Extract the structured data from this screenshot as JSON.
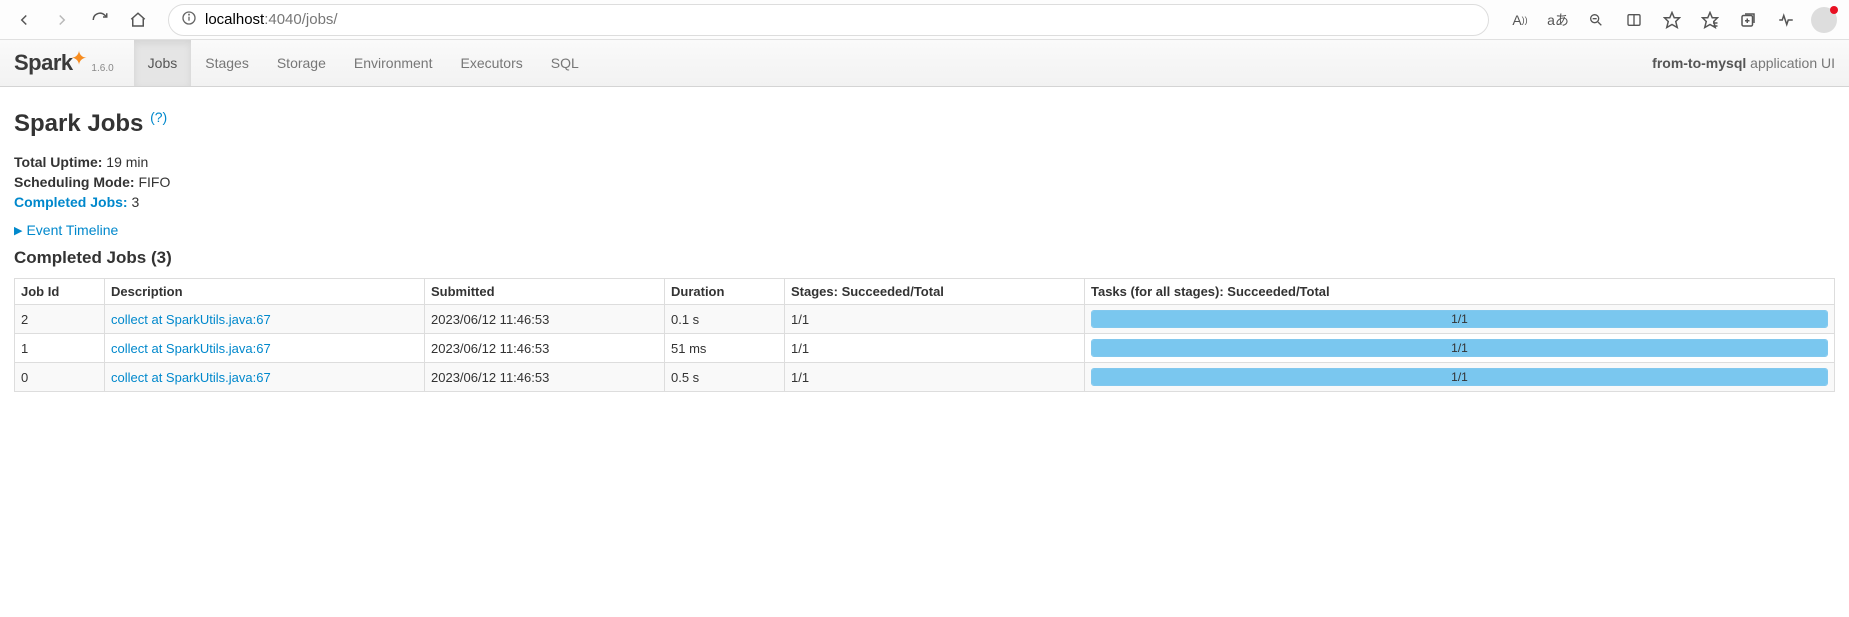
{
  "browser": {
    "url_host": "localhost",
    "url_port": ":4040",
    "url_path": "/jobs/"
  },
  "nav": {
    "version": "1.6.0",
    "tabs": [
      "Jobs",
      "Stages",
      "Storage",
      "Environment",
      "Executors",
      "SQL"
    ],
    "active_tab": "Jobs",
    "app_name": "from-to-mysql",
    "app_suffix": "application UI"
  },
  "page": {
    "title": "Spark Jobs",
    "help": "(?)",
    "summary": {
      "uptime_label": "Total Uptime:",
      "uptime_value": "19 min",
      "sched_label": "Scheduling Mode:",
      "sched_value": "FIFO",
      "completed_label": "Completed Jobs:",
      "completed_value": "3"
    },
    "timeline_label": "Event Timeline",
    "section_title": "Completed Jobs (3)",
    "table": {
      "headers": {
        "jobid": "Job Id",
        "desc": "Description",
        "submitted": "Submitted",
        "duration": "Duration",
        "stages": "Stages: Succeeded/Total",
        "tasks": "Tasks (for all stages): Succeeded/Total"
      },
      "rows": [
        {
          "jobid": "2",
          "desc": "collect at SparkUtils.java:67",
          "submitted": "2023/06/12 11:46:53",
          "duration": "0.1 s",
          "stages": "1/1",
          "tasks": "1/1",
          "progress_pct": 100
        },
        {
          "jobid": "1",
          "desc": "collect at SparkUtils.java:67",
          "submitted": "2023/06/12 11:46:53",
          "duration": "51 ms",
          "stages": "1/1",
          "tasks": "1/1",
          "progress_pct": 100
        },
        {
          "jobid": "0",
          "desc": "collect at SparkUtils.java:67",
          "submitted": "2023/06/12 11:46:53",
          "duration": "0.5 s",
          "stages": "1/1",
          "tasks": "1/1",
          "progress_pct": 100
        }
      ]
    }
  }
}
